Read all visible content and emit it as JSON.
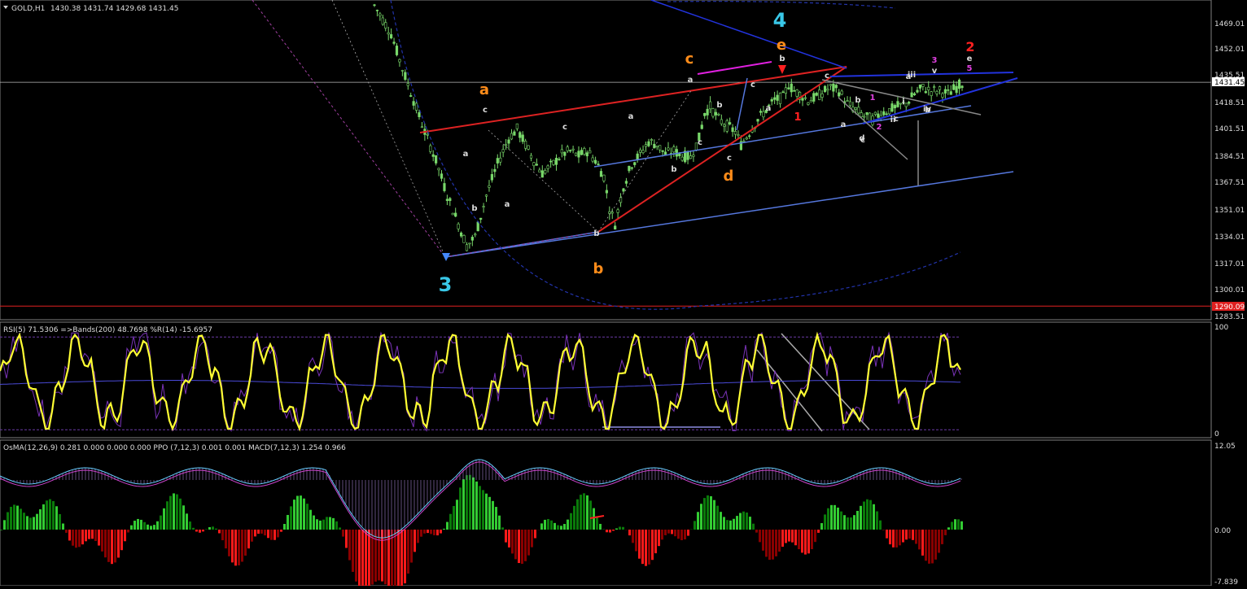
{
  "header": {
    "symbol": "GOLD,H1",
    "ohlc": "1430.38 1431.74 1429.68 1431.45",
    "menu_icon": "triangle-down-icon"
  },
  "main_axis": {
    "ticks": [
      "1469.01",
      "1452.01",
      "1435.51",
      "1418.51",
      "1401.51",
      "1384.51",
      "1367.51",
      "1351.01",
      "1334.01",
      "1317.01",
      "1300.01",
      "1283.51"
    ],
    "current_price": "1431.45",
    "red_level": "1290.09"
  },
  "rsi_panel": {
    "header": "RSI(5) 71.5306  =>Bands(200) 48.7698  %R(14) -15.6957",
    "ticks": [
      "100",
      "0"
    ]
  },
  "osma_panel": {
    "header": "OsMA(12,26,9) 0.281 0.000 0.000 0.000  PPO (7,12,3) 0.001 0.001  MACD(7,12,3) 1.254 0.966",
    "ticks": [
      "12.05",
      "0.00",
      "-7.839"
    ]
  },
  "wave_labels": {
    "big": [
      {
        "t": "3",
        "c": "#39c8e8"
      },
      {
        "t": "4",
        "c": "#39c8e8"
      },
      {
        "t": "2",
        "c": "#ff2020"
      }
    ],
    "orange": [
      "a",
      "b",
      "c",
      "d",
      "e"
    ],
    "red": [
      "1"
    ],
    "white": [
      "c",
      "a",
      "b",
      "a",
      "c",
      "b",
      "a",
      "b",
      "c",
      "a",
      "b",
      "c",
      "c",
      "a",
      "b",
      "c",
      "a",
      "b",
      "c",
      "a",
      "c",
      "b",
      "d",
      "i",
      "ii",
      "iii",
      "iv",
      "v",
      "e"
    ],
    "magenta": [
      "1",
      "2",
      "3",
      "5"
    ]
  },
  "colors": {
    "bull": "#79d86a",
    "bear": "#79d86a",
    "grid": "#2a2a2a",
    "rsi_line": "#ffff33",
    "rsi_thin": "#7a33b8",
    "osma_pos_light": "#33cc33",
    "osma_pos_dark": "#0a7a0a",
    "osma_neg_light": "#ff1a1a",
    "osma_neg_dark": "#8a0000"
  },
  "chart_data": {
    "type": "candlestick",
    "symbol": "GOLD",
    "timeframe": "H1",
    "ylim": [
      1283.51,
      1469.01
    ],
    "last_close": 1431.45,
    "red_horizontal_level": 1290.09,
    "subcharts": [
      {
        "name": "RSI(5)",
        "value": 71.5306,
        "ylim": [
          0,
          100
        ]
      },
      {
        "name": "Bands(200)",
        "value": 48.7698
      },
      {
        "name": "%R(14)",
        "value": -15.6957
      },
      {
        "name": "MACD(7,12,3)",
        "values": [
          1.254,
          0.966
        ],
        "ylim": [
          -7.839,
          12.05
        ]
      }
    ],
    "price_path": [
      [
        0,
        1480
      ],
      [
        6,
        1462
      ],
      [
        10,
        1440
      ],
      [
        14,
        1420
      ],
      [
        18,
        1400
      ],
      [
        22,
        1382
      ],
      [
        26,
        1360
      ],
      [
        30,
        1342
      ],
      [
        33,
        1328
      ],
      [
        36,
        1334
      ],
      [
        40,
        1360
      ],
      [
        44,
        1380
      ],
      [
        48,
        1396
      ],
      [
        51,
        1402
      ],
      [
        54,
        1392
      ],
      [
        57,
        1382
      ],
      [
        60,
        1374
      ],
      [
        64,
        1380
      ],
      [
        67,
        1386
      ],
      [
        70,
        1388
      ],
      [
        73,
        1385
      ],
      [
        76,
        1388
      ],
      [
        79,
        1382
      ],
      [
        82,
        1372
      ],
      [
        84,
        1352
      ],
      [
        86,
        1342
      ],
      [
        89,
        1366
      ],
      [
        92,
        1380
      ],
      [
        95,
        1386
      ],
      [
        98,
        1394
      ],
      [
        101,
        1392
      ],
      [
        104,
        1386
      ],
      [
        107,
        1388
      ],
      [
        110,
        1385
      ],
      [
        113,
        1384
      ],
      [
        116,
        1396
      ],
      [
        118,
        1412
      ],
      [
        120,
        1416
      ],
      [
        123,
        1408
      ],
      [
        126,
        1404
      ],
      [
        129,
        1400
      ],
      [
        131,
        1392
      ],
      [
        134,
        1400
      ],
      [
        137,
        1408
      ],
      [
        140,
        1414
      ],
      [
        143,
        1420
      ],
      [
        146,
        1422
      ],
      [
        148,
        1430
      ],
      [
        150,
        1426
      ],
      [
        152,
        1424
      ],
      [
        155,
        1420
      ],
      [
        158,
        1422
      ],
      [
        161,
        1426
      ],
      [
        163,
        1428
      ],
      [
        166,
        1426
      ],
      [
        169,
        1418
      ],
      [
        172,
        1414
      ],
      [
        175,
        1410
      ],
      [
        178,
        1408
      ],
      [
        181,
        1412
      ],
      [
        184,
        1414
      ],
      [
        187,
        1416
      ],
      [
        190,
        1418
      ],
      [
        193,
        1424
      ],
      [
        196,
        1428
      ],
      [
        199,
        1426
      ],
      [
        202,
        1426
      ],
      [
        205,
        1424
      ],
      [
        207,
        1427
      ],
      [
        210,
        1431
      ]
    ]
  }
}
